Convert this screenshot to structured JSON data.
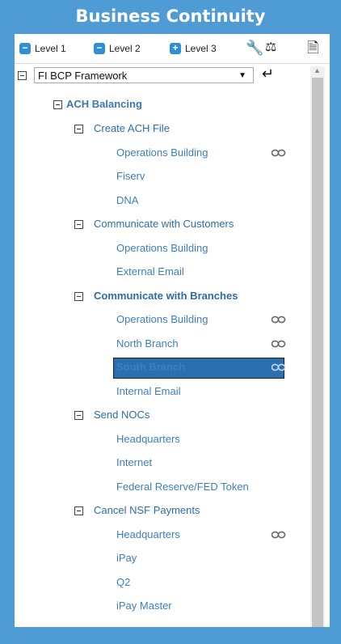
{
  "header": {
    "title": "Business Continuity"
  },
  "toolbar": {
    "level1": "Level 1",
    "level2": "Level 2",
    "level3": "Level 3",
    "icons": [
      "wrench-icon",
      "scales-icon",
      "document-icon"
    ]
  },
  "framework_select": {
    "value": "FI BCP Framework"
  },
  "tree": {
    "process": "ACH Balancing",
    "items": [
      {
        "label": "Create ACH File",
        "level": 2
      },
      {
        "label": "Operations Building",
        "level": 3,
        "linked": true
      },
      {
        "label": "Fiserv",
        "level": 3
      },
      {
        "label": "DNA",
        "level": 3
      },
      {
        "label": "Communicate with Customers",
        "level": 2
      },
      {
        "label": "Operations Building",
        "level": 3
      },
      {
        "label": "External Email",
        "level": 3
      },
      {
        "label": "Communicate with Branches",
        "level": 2,
        "bold": true
      },
      {
        "label": "Operations Building",
        "level": 3,
        "linked": true
      },
      {
        "label": "North Branch",
        "level": 3,
        "linked": true
      },
      {
        "label": "South Branch",
        "level": 3,
        "linked": true,
        "selected": true
      },
      {
        "label": "Internal Email",
        "level": 3
      },
      {
        "label": "Send NOCs",
        "level": 2
      },
      {
        "label": "Headquarters",
        "level": 3
      },
      {
        "label": "Internet",
        "level": 3
      },
      {
        "label": "Federal Reserve/FED Token",
        "level": 3
      },
      {
        "label": "Cancel NSF Payments",
        "level": 2
      },
      {
        "label": "Headquarters",
        "level": 3,
        "linked": true
      },
      {
        "label": "iPay",
        "level": 3
      },
      {
        "label": "Q2",
        "level": 3
      },
      {
        "label": "iPay Master",
        "level": 3
      }
    ]
  },
  "colors": {
    "background": "#4f9bd6",
    "selected": "#2a6fb0",
    "link_text": "#2b6ea7"
  }
}
